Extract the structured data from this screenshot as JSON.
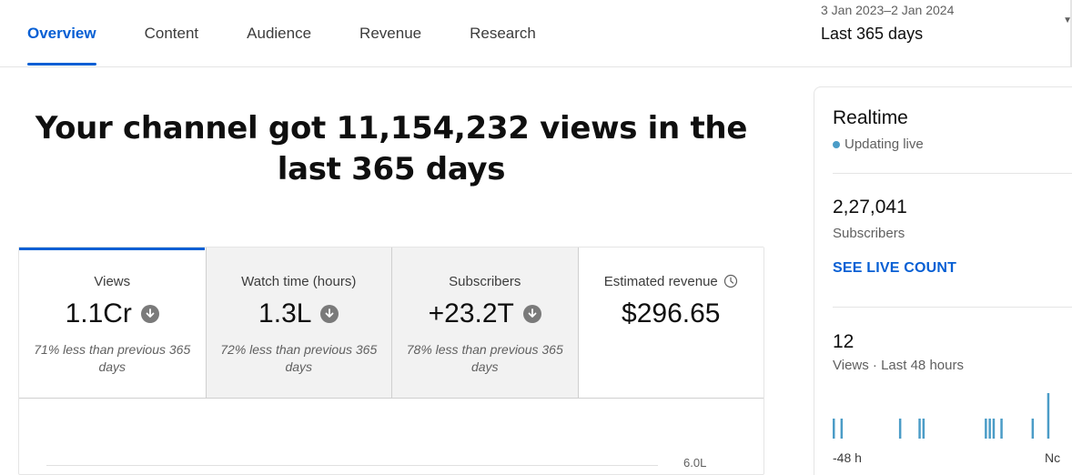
{
  "nav": {
    "tabs": [
      {
        "label": "Overview",
        "active": true
      },
      {
        "label": "Content",
        "active": false
      },
      {
        "label": "Audience",
        "active": false
      },
      {
        "label": "Revenue",
        "active": false
      },
      {
        "label": "Research",
        "active": false
      }
    ],
    "date_range": "3 Jan 2023–2 Jan 2024",
    "period": "Last 365 days"
  },
  "headline": "Your channel got 11,154,232 views in the last 365 days",
  "metrics": [
    {
      "label": "Views",
      "value": "1.1Cr",
      "trend": "down",
      "comparison": "71% less than previous 365 days"
    },
    {
      "label": "Watch time (hours)",
      "value": "1.3L",
      "trend": "down",
      "comparison": "72% less than previous 365 days"
    },
    {
      "label": "Subscribers",
      "value": "+23.2T",
      "trend": "down",
      "comparison": "78% less than previous 365 days"
    },
    {
      "label": "Estimated revenue",
      "value": "$296.65",
      "trend": "",
      "comparison": ""
    }
  ],
  "chart": {
    "y_tick": "6.0L"
  },
  "realtime": {
    "title": "Realtime",
    "status": "Updating live",
    "subscribers_value": "2,27,041",
    "subscribers_label": "Subscribers",
    "live_count_link": "SEE LIVE COUNT",
    "views_value": "12",
    "views_label": "Views · Last 48 hours",
    "spark_start": "-48 h",
    "spark_end": "Nc",
    "spark_values": [
      1,
      0,
      1,
      0,
      0,
      0,
      0,
      0,
      0,
      0,
      0,
      0,
      0,
      0,
      0,
      0,
      0,
      1,
      0,
      0,
      0,
      0,
      1,
      1,
      0,
      0,
      0,
      0,
      0,
      0,
      0,
      0,
      0,
      0,
      0,
      0,
      0,
      0,
      0,
      1,
      1,
      1,
      0,
      1,
      0,
      0,
      0,
      0,
      0,
      0,
      0,
      1,
      0,
      0,
      0,
      2
    ],
    "colors": {
      "accent": "#065fd4",
      "bar": "#4b9cc7",
      "live_dot": "#4b9cc7"
    }
  }
}
